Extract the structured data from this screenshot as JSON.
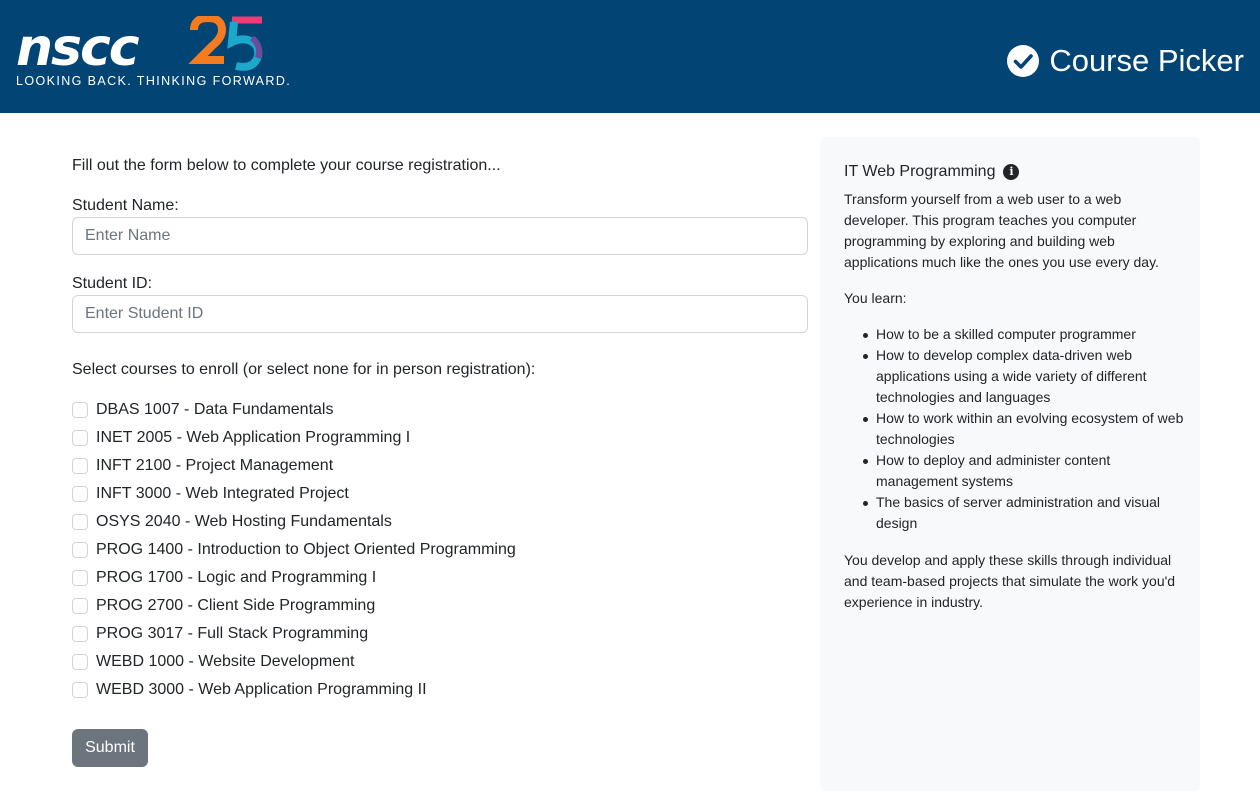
{
  "header": {
    "logo_text": "nscc",
    "logo_anniversary": "25",
    "tagline": "LOOKING BACK. THINKING FORWARD.",
    "app_title": "Course Picker",
    "brand_color": "#024474",
    "title_icon": "check-circle-icon"
  },
  "form": {
    "intro": "Fill out the form below to complete your course registration...",
    "name_label": "Student Name:",
    "name_placeholder": "Enter Name",
    "name_value": "",
    "id_label": "Student ID:",
    "id_placeholder": "Enter Student ID",
    "id_value": "",
    "courses_label": "Select courses to enroll (or select none for in person registration):",
    "courses": [
      {
        "label": "DBAS 1007 - Data Fundamentals",
        "checked": false
      },
      {
        "label": "INET 2005 - Web Application Programming I",
        "checked": false
      },
      {
        "label": "INFT 2100 - Project Management",
        "checked": false
      },
      {
        "label": "INFT 3000 - Web Integrated Project",
        "checked": false
      },
      {
        "label": "OSYS 2040 - Web Hosting Fundamentals",
        "checked": false
      },
      {
        "label": "PROG 1400 - Introduction to Object Oriented Programming",
        "checked": false
      },
      {
        "label": "PROG 1700 - Logic and Programming I",
        "checked": false
      },
      {
        "label": "PROG 2700 - Client Side Programming",
        "checked": false
      },
      {
        "label": "PROG 3017 - Full Stack Programming",
        "checked": false
      },
      {
        "label": "WEBD 1000 - Website Development",
        "checked": false
      },
      {
        "label": "WEBD 3000 - Web Application Programming II",
        "checked": false
      }
    ],
    "submit_label": "Submit"
  },
  "sidebar": {
    "title": "IT Web Programming",
    "title_icon": "info-icon",
    "intro": "Transform yourself from a web user to a web developer. This program teaches you computer programming by exploring and building web applications much like the ones you use every day.",
    "learn_label": "You learn:",
    "learn_items": [
      "How to be a skilled computer programmer",
      "How to develop complex data-driven web applications using a wide variety of different technologies and languages",
      "How to work within an evolving ecosystem of web technologies",
      "How to deploy and administer content management systems",
      "The basics of server administration and visual design"
    ],
    "outro": "You develop and apply these skills through individual and team-based projects that simulate the work you'd experience in industry."
  }
}
